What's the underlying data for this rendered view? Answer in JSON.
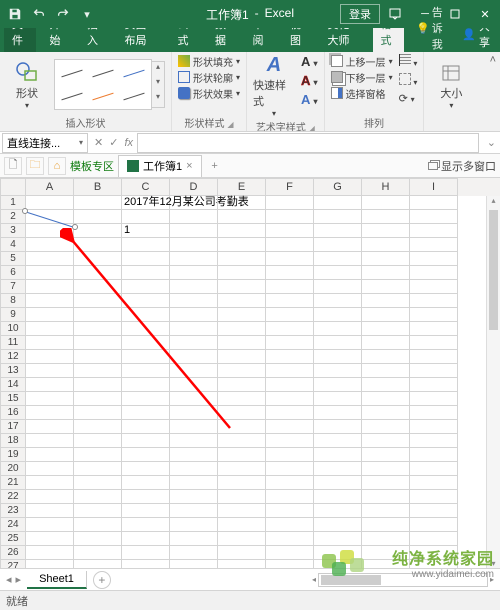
{
  "title": {
    "doc": "工作簿1",
    "app": "Excel"
  },
  "login": "登录",
  "tabs": [
    "文件",
    "开始",
    "插入",
    "页面布局",
    "公式",
    "数据",
    "审阅",
    "视图",
    "美化大师",
    "格式"
  ],
  "activeTab": "格式",
  "tellMe": "告诉我",
  "share": "共享",
  "ribbon": {
    "insertShapes": {
      "btn": "形状",
      "group": "插入形状"
    },
    "shapeStyles": {
      "fill": "形状填充",
      "outline": "形状轮廓",
      "effects": "形状效果",
      "group": "形状样式"
    },
    "wordart": {
      "btn": "快速样式",
      "group": "艺术字样式"
    },
    "arrange": {
      "bringFwd": "上移一层",
      "sendBack": "下移一层",
      "selPane": "选择窗格",
      "group": "排列"
    },
    "size": {
      "btn": "大小",
      "group": ""
    }
  },
  "namebox": "直线连接...",
  "docTabs": {
    "template": "模板专区",
    "workbook": "工作簿1"
  },
  "displayMulti": "显示多窗口",
  "columns": [
    "A",
    "B",
    "C",
    "D",
    "E",
    "F",
    "G",
    "H",
    "I"
  ],
  "rowCount": 28,
  "cells": {
    "C1": "2017年12月某公司考勤表",
    "C3": "1"
  },
  "sheet": "Sheet1",
  "status": "就绪",
  "watermark": {
    "cn": "纯净系统家园",
    "url": "www.yidaimei.com"
  }
}
